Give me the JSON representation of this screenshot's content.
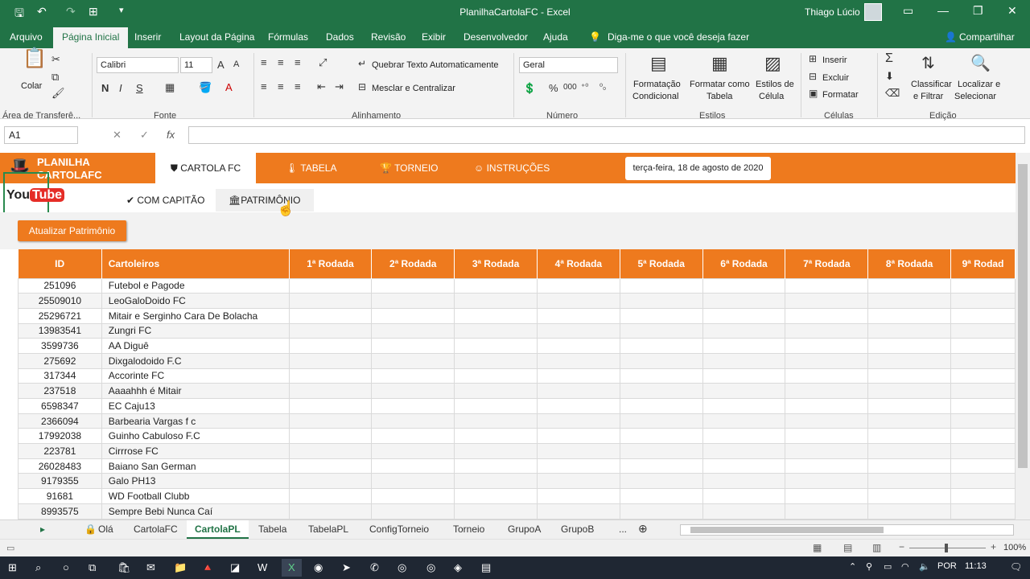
{
  "window": {
    "title": "PlanilhaCartolaFC - Excel",
    "user": "Thiago Lúcio"
  },
  "menu": [
    "Arquivo",
    "Página Inicial",
    "Inserir",
    "Layout da Página",
    "Fórmulas",
    "Dados",
    "Revisão",
    "Exibir",
    "Desenvolvedor",
    "Ajuda"
  ],
  "tell_me": "Diga-me o que você deseja fazer",
  "share": "Compartilhar",
  "ribbon": {
    "clipboard": {
      "paste": "Colar",
      "group": "Área de Transferê..."
    },
    "font": {
      "name": "Calibri",
      "size": "11",
      "group": "Fonte",
      "bold": "N",
      "italic": "I",
      "underline": "S"
    },
    "alignment": {
      "wrap": "Quebrar Texto Automaticamente",
      "merge": "Mesclar e Centralizar",
      "group": "Alinhamento"
    },
    "number": {
      "format": "Geral",
      "group": "Número",
      "percent": "%",
      "thousands": "000"
    },
    "styles": {
      "cond": "Formatação",
      "cond2": "Condicional",
      "table": "Formatar como",
      "table2": "Tabela",
      "cell": "Estilos de",
      "cell2": "Célula",
      "group": "Estilos"
    },
    "cells": {
      "insert": "Inserir",
      "delete": "Excluir",
      "format": "Formatar",
      "group": "Células"
    },
    "editing": {
      "sort": "Classificar",
      "sort2": "e Filtrar",
      "find": "Localizar e",
      "find2": "Selecionar",
      "group": "Edição"
    }
  },
  "formula": {
    "namebox": "A1",
    "fx": "fx",
    "value": ""
  },
  "app": {
    "logo": "PLANILHA CARTOLAFC",
    "nav": [
      "CARTOLA FC",
      "TABELA",
      "TORNEIO",
      "INSTRUÇÕES"
    ],
    "date": "terça-feira, 18 de agosto de 2020",
    "subtabs": [
      "COM CAPITÃO",
      "PATRIMÔNIO"
    ],
    "youtube": {
      "you": "You",
      "tube": "Tube"
    },
    "update_button": "Atualizar Patrimônio"
  },
  "table": {
    "headers": [
      "ID",
      "Cartoleiros",
      "1ª Rodada",
      "2ª Rodada",
      "3ª Rodada",
      "4ª Rodada",
      "5ª Rodada",
      "6ª Rodada",
      "7ª Rodada",
      "8ª Rodada",
      "9ª Rodad"
    ],
    "rows": [
      [
        "251096",
        "Futebol e Pagode"
      ],
      [
        "25509010",
        "LeoGaloDoido FC"
      ],
      [
        "25296721",
        "Mitair e Serginho Cara De Bolacha"
      ],
      [
        "13983541",
        "Zungri FC"
      ],
      [
        "3599736",
        "AA Diguê"
      ],
      [
        "275692",
        "Dixgalodoido F.C"
      ],
      [
        "317344",
        "Accorinte FC"
      ],
      [
        "237518",
        "Aaaahhh é Mitair"
      ],
      [
        "6598347",
        "EC Caju13"
      ],
      [
        "2366094",
        "Barbearia Vargas f c"
      ],
      [
        "17992038",
        "Guinho Cabuloso F.C"
      ],
      [
        "223781",
        "Cirrrose FC"
      ],
      [
        "26028483",
        "Baiano San German"
      ],
      [
        "9179355",
        "Galo PH13"
      ],
      [
        "91681",
        "WD Football Clubb"
      ],
      [
        "8993575",
        "Sempre Bebi Nunca Caí"
      ]
    ]
  },
  "sheet_tabs": [
    "Olá",
    "CartolaFC",
    "CartolaPL",
    "Tabela",
    "TabelaPL",
    "ConfigTorneio",
    "Torneio",
    "GrupoA",
    "GrupoB",
    "..."
  ],
  "status": {
    "zoom": "100%"
  },
  "taskbar": {
    "lang": "POR",
    "time": "11:13"
  }
}
